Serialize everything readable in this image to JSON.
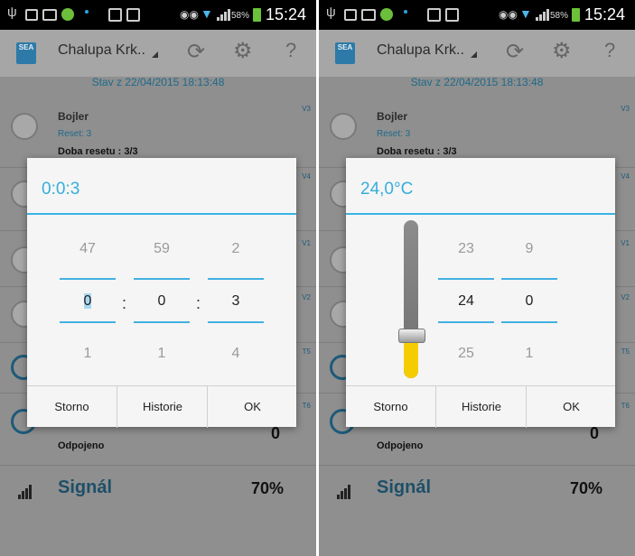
{
  "status_bar": {
    "battery": "58%",
    "time": "15:24"
  },
  "app": {
    "logo": "SEA",
    "title": "Chalupa Krk..",
    "icons": [
      "refresh-icon",
      "gear-icon",
      "help-icon"
    ],
    "help_label": "?"
  },
  "background": {
    "stav": "Stav z 22/04/2015 18:13:48",
    "bojler": {
      "name": "Bojler",
      "reset": "Reset: 3",
      "doba": "Doba resetu : 3/3",
      "tag": "V3"
    },
    "tags": [
      "V4",
      "V1",
      "V2",
      "T5",
      "T6"
    ],
    "last_value": "0",
    "odpojeno": "Odpojeno",
    "signal_label": "Signál",
    "signal_value": "70%"
  },
  "time_dialog": {
    "title": "0:0:3",
    "columns": [
      {
        "prev": "47",
        "current": "0",
        "next": "1"
      },
      {
        "prev": "59",
        "current": "0",
        "next": "1"
      },
      {
        "prev": "2",
        "current": "3",
        "next": "4"
      }
    ],
    "separator": ":",
    "buttons": {
      "cancel": "Storno",
      "history": "Historie",
      "ok": "OK"
    }
  },
  "temp_dialog": {
    "title": "24,0°C",
    "slider_level": 0.27,
    "columns": [
      {
        "prev": "23",
        "current": "24",
        "next": "25"
      },
      {
        "prev": "9",
        "current": "0",
        "next": "1"
      }
    ],
    "buttons": {
      "cancel": "Storno",
      "history": "Historie",
      "ok": "OK"
    }
  },
  "colors": {
    "accent": "#3ab3e3",
    "slider_fill": "#f5cc00"
  }
}
